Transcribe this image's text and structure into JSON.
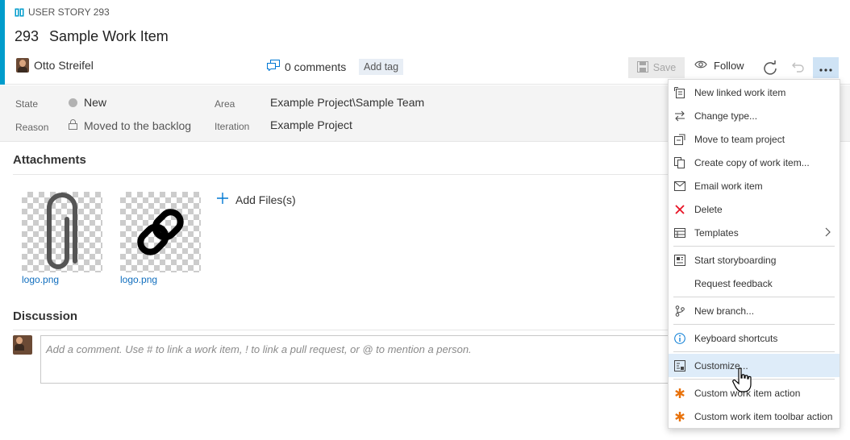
{
  "work_item": {
    "type_label": "USER STORY 293",
    "id": "293",
    "title": "Sample Work Item",
    "assigned_to": "Otto Streifel",
    "comments_count": "0 comments",
    "add_tag_label": "Add tag"
  },
  "toolbar": {
    "save_label": "Save",
    "follow_label": "Follow"
  },
  "fields": {
    "state_label": "State",
    "state_value": "New",
    "reason_label": "Reason",
    "reason_value": "Moved to the backlog",
    "area_label": "Area",
    "area_value": "Example Project\\Sample Team",
    "iteration_label": "Iteration",
    "iteration_value": "Example Project"
  },
  "attachments": {
    "title": "Attachments",
    "add_files_label": "Add Files(s)",
    "files": [
      {
        "name": "logo.png",
        "icon": "paperclip-icon"
      },
      {
        "name": "logo.png",
        "icon": "link-icon"
      }
    ]
  },
  "discussion": {
    "title": "Discussion",
    "placeholder": "Add a comment. Use # to link a work item, ! to link a pull request, or @ to mention a person."
  },
  "menu": {
    "items": [
      {
        "label": "New linked work item",
        "icon": "linked-item-icon"
      },
      {
        "label": "Change type...",
        "icon": "swap-arrows-icon"
      },
      {
        "label": "Move to team project",
        "icon": "move-project-icon"
      },
      {
        "label": "Create copy of work item...",
        "icon": "copy-icon"
      },
      {
        "label": "Email work item",
        "icon": "mail-icon"
      },
      {
        "label": "Delete",
        "icon": "delete-x-icon"
      },
      {
        "label": "Templates",
        "icon": "templates-icon"
      },
      {
        "label": "Start storyboarding",
        "icon": "storyboard-icon"
      },
      {
        "label": "Request feedback",
        "icon": ""
      },
      {
        "label": "New branch...",
        "icon": "branch-icon"
      },
      {
        "label": "Keyboard shortcuts",
        "icon": "info-icon"
      },
      {
        "label": "Customize...",
        "icon": "customize-icon"
      },
      {
        "label": "Custom work item action",
        "icon": "asterisk-icon"
      },
      {
        "label": "Custom work item toolbar action",
        "icon": "asterisk-icon"
      }
    ]
  },
  "colors": {
    "accent": "#009ccc",
    "link": "#106ebe",
    "menu_hover": "#deecf9",
    "delete_red": "#e81123",
    "asterisk_orange": "#e8710a"
  }
}
